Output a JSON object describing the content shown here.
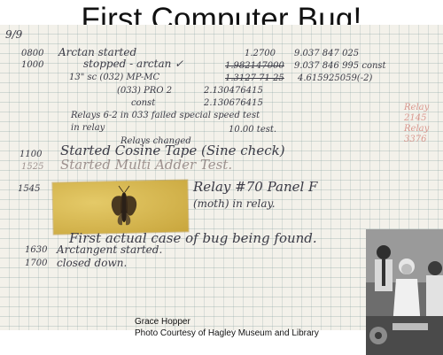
{
  "slide": {
    "title": "First Computer Bug!"
  },
  "log": {
    "date": "9/9",
    "entries": [
      {
        "time": "0800",
        "text": "Arctan started"
      },
      {
        "time": "1000",
        "text": "stopped - arctan ✓"
      },
      {
        "time": "",
        "text": "13\" sc (032) MP-MC"
      },
      {
        "time": "",
        "text": "(033) PRO 2"
      },
      {
        "time": "",
        "text": "const"
      },
      {
        "time": "",
        "text": "Relays 6-2 in 033 failed special speed test"
      },
      {
        "time": "",
        "text": "in relay"
      },
      {
        "time": "",
        "text": "10.00 test."
      },
      {
        "time": "",
        "text": "Relays changed"
      },
      {
        "time": "1100",
        "text": "Started Cosine Tape (Sine check)"
      },
      {
        "time": "1525",
        "text": "Started Multi Adder Test."
      },
      {
        "time": "1545",
        "text": "Relay #70 Panel F"
      },
      {
        "time": "",
        "text": "(moth) in relay."
      },
      {
        "time": "",
        "text": "First actual case of bug being found."
      },
      {
        "time": "1630",
        "text": "Arctangent started."
      },
      {
        "time": "1700",
        "text": "closed down."
      }
    ],
    "values": [
      "1.2700",
      "9.037 847 025",
      "1.982147000",
      "9.037 846 995 const",
      "1.3127 71 25",
      "4.615925059(-2)",
      "2.130476415",
      "2.130676415"
    ],
    "margin_note": "Relay 2145 Relay 3376"
  },
  "caption": {
    "line1": "Grace Hopper",
    "line2": "Photo Courtesy of Hagley Museum and Library"
  }
}
